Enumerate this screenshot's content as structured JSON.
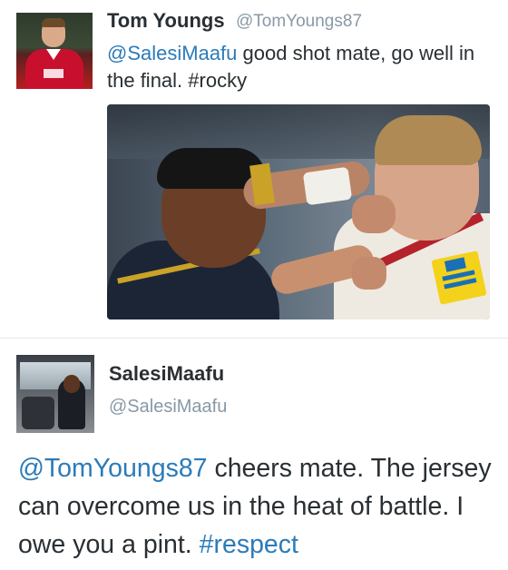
{
  "tweet1": {
    "display_name": "Tom Youngs",
    "handle": "@TomYoungs87",
    "text_mention": "@SalesiMaafu",
    "text_body": " good shot mate, go well in the final. ",
    "text_hashtag": "#rocky"
  },
  "tweet2": {
    "display_name": "SalesiMaafu",
    "handle": "@SalesiMaafu",
    "text_mention": "@TomYoungs87",
    "text_body": " cheers mate. The jersey can overcome us in the heat of battle. I owe you a pint. ",
    "text_hashtag": "#respect"
  },
  "colors": {
    "link": "#2b7bb9",
    "handle": "#8899a6",
    "text": "#292f33",
    "divider": "#e1e8ed"
  },
  "icons": {
    "avatar_1": "profile-photo-rugby-player",
    "avatar_2": "profile-photo-cockpit",
    "photo": "rugby-tackle-photo"
  }
}
